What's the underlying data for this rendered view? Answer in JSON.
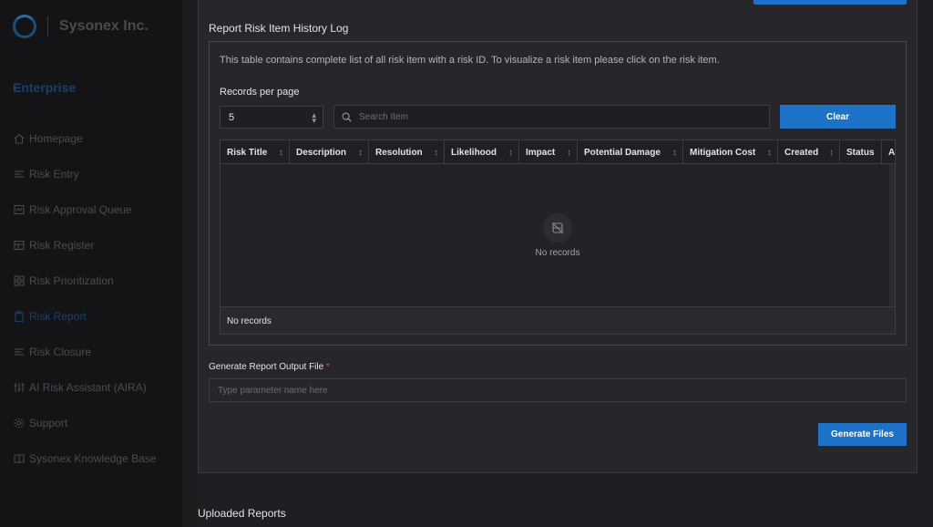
{
  "brand": {
    "name": "Sysonex Inc."
  },
  "sidebar": {
    "section": "Enterprise",
    "items": [
      {
        "label": "Homepage",
        "icon": "home-icon"
      },
      {
        "label": "Risk Entry",
        "icon": "list-icon"
      },
      {
        "label": "Risk Approval Queue",
        "icon": "queue-icon"
      },
      {
        "label": "Risk Register",
        "icon": "register-icon"
      },
      {
        "label": "Risk Prioritization",
        "icon": "grid-icon"
      },
      {
        "label": "Risk Report",
        "icon": "clipboard-icon",
        "active": true
      },
      {
        "label": "Risk Closure",
        "icon": "list-icon"
      },
      {
        "label": "AI Risk Assistant (AIRA)",
        "icon": "sliders-icon"
      },
      {
        "label": "Support",
        "icon": "gear-icon"
      },
      {
        "label": "Sysonex Knowledge Base",
        "icon": "book-icon"
      }
    ]
  },
  "report": {
    "title": "Report Risk Item History Log",
    "description": "This table contains complete list of all risk item with a risk ID. To visualize a risk item please click on the risk item.",
    "records_per_page_label": "Records per page",
    "records_per_page_value": "5",
    "search_placeholder": "Search Item",
    "clear_label": "Clear",
    "columns": [
      "Risk Title",
      "Description",
      "Resolution",
      "Likelihood",
      "Impact",
      "Potential Damage",
      "Mitigation Cost",
      "Created",
      "Status",
      "A"
    ],
    "empty_text": "No records",
    "footer_text": "No records"
  },
  "output": {
    "label": "Generate Report Output File",
    "required_mark": "*",
    "placeholder": "Type parameter name here",
    "generate_label": "Generate Files"
  },
  "uploaded": {
    "title": "Uploaded Reports"
  },
  "colors": {
    "accent": "#1e73c9",
    "required": "#e5484d"
  }
}
